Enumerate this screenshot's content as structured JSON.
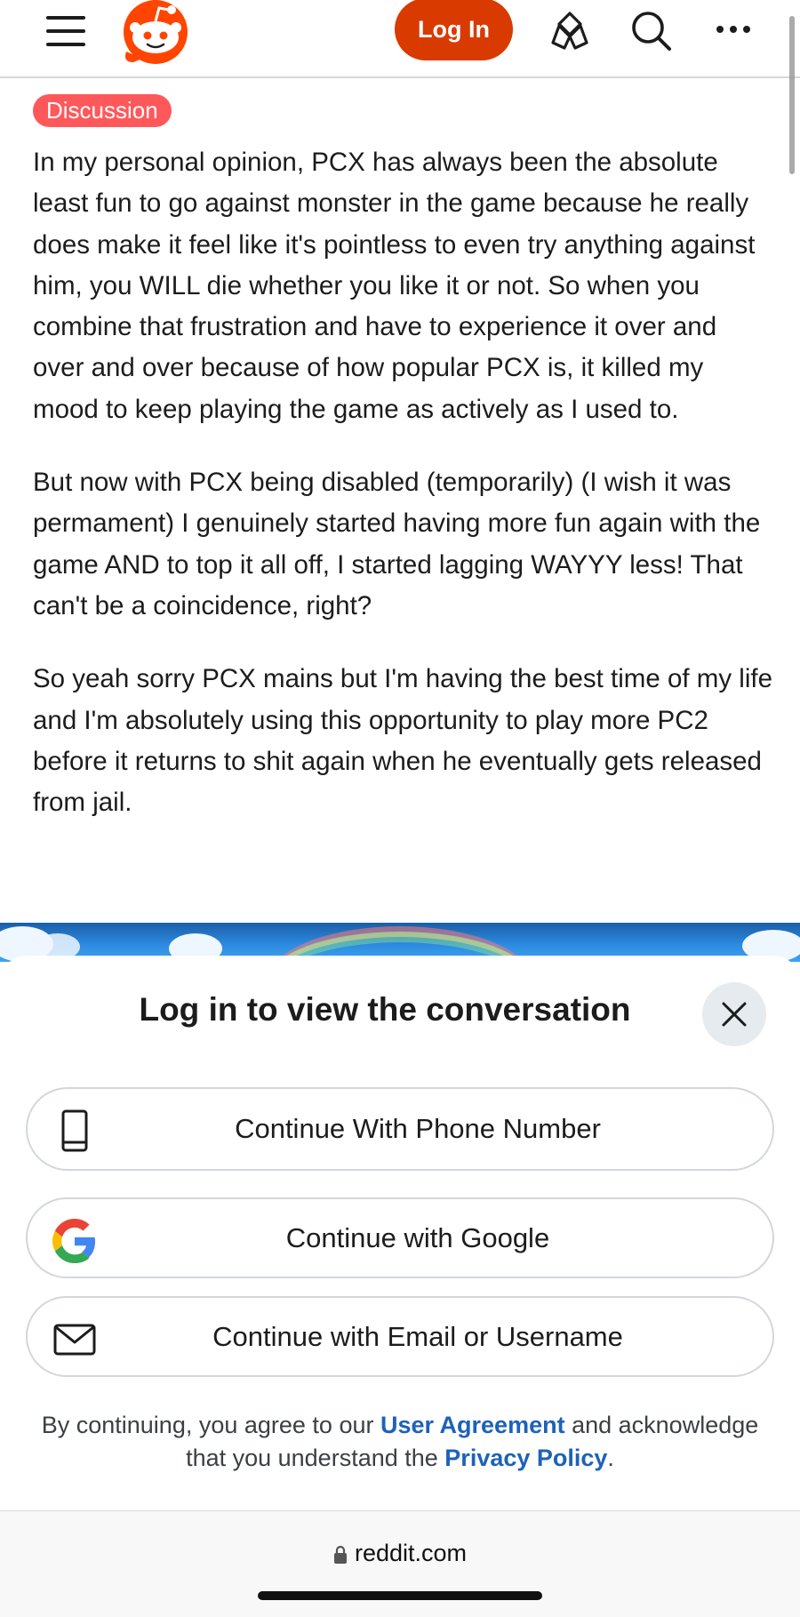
{
  "header": {
    "login_label": "Log In",
    "icons": [
      "hamburger-icon",
      "reddit-logo",
      "popular-icon",
      "search-icon",
      "more-icon"
    ]
  },
  "post": {
    "flair": "Discussion",
    "paragraphs": [
      "In my personal opinion, PCX has always been the absolute least fun to go against monster in the game because he really does make it feel like it's pointless to even try anything against him, you WILL die whether you like it or not. So when you combine that frustration and have to experience it over and over and over because of how popular PCX is, it killed my mood to keep playing the game as actively as I used to.",
      "But now with PCX being disabled (temporarily) (I wish it was permament) I genuinely started having more fun again with the game AND to top it all off, I started lagging WAYYY less! That can't be a coincidence, right?",
      "So yeah sorry PCX mains but I'm having the best time of my life and I'm absolutely using this opportunity to play more PC2 before it returns to shit again when he eventually gets released from jail."
    ]
  },
  "login_sheet": {
    "title": "Log in to view the conversation",
    "buttons": {
      "phone": "Continue With Phone Number",
      "google": "Continue with Google",
      "email": "Continue with Email or Username"
    },
    "legal": {
      "prefix": "By continuing, you agree to our",
      "user_agreement": "User Agreement",
      "middle": "and acknowledge that you understand the",
      "privacy_policy": "Privacy Policy",
      "suffix": "."
    }
  },
  "browser": {
    "url": "reddit.com"
  },
  "colors": {
    "brand_orange": "#d93a00",
    "flair_bg": "#ff585b",
    "link_blue": "#1e62b8"
  }
}
